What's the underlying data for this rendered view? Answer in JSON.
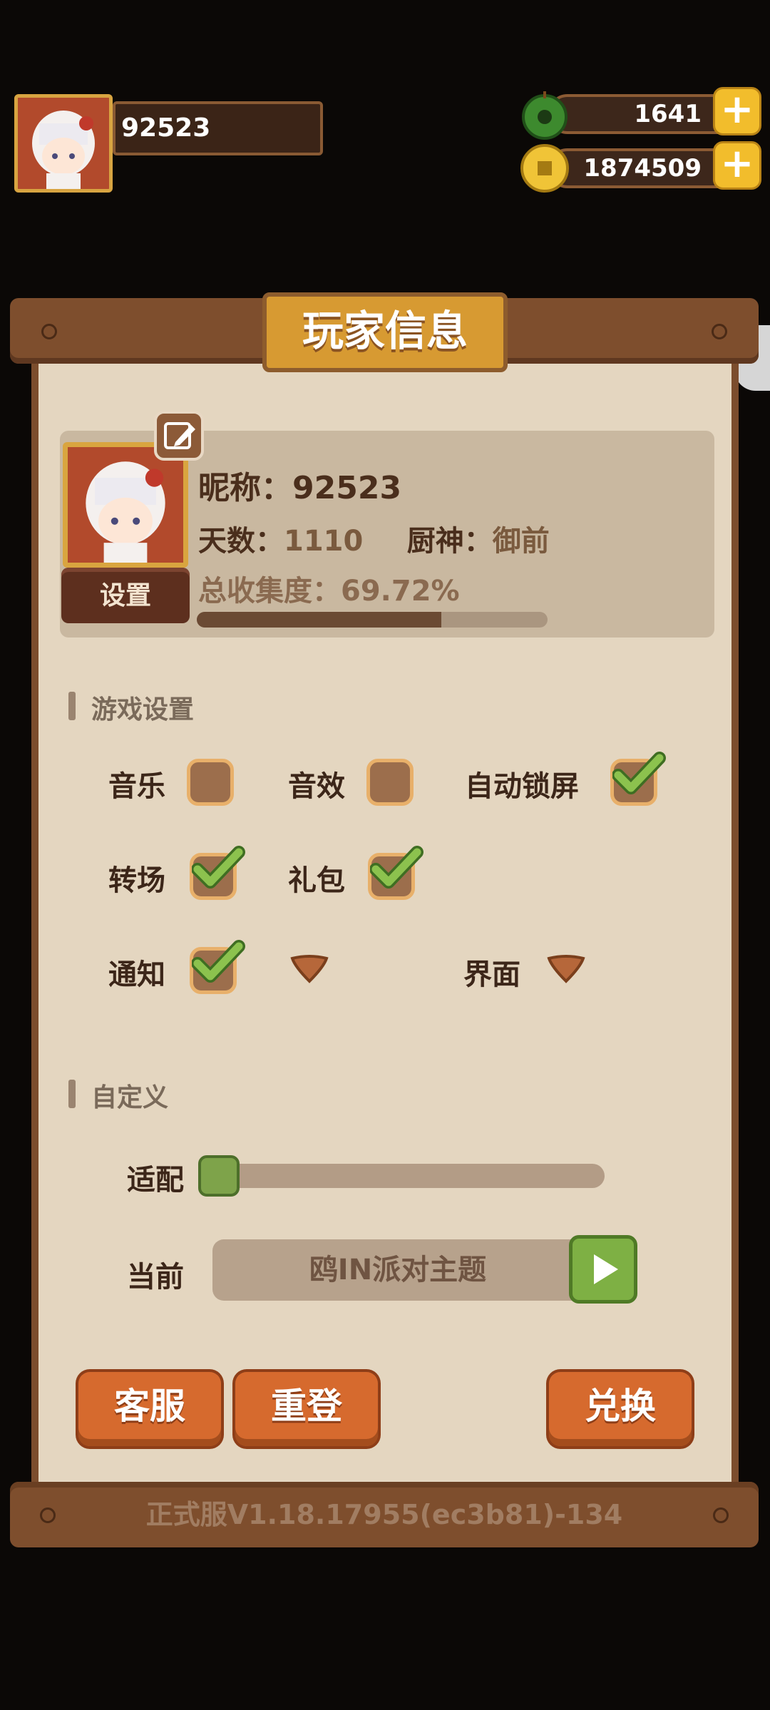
{
  "hud": {
    "player_id": "92523",
    "jade_amount": "1641",
    "coin_amount": "1874509",
    "plus_symbol": "+"
  },
  "panel": {
    "title": "玩家信息",
    "profile": {
      "nickname_label": "昵称：",
      "nickname_value": "92523",
      "days_label": "天数：",
      "days_value": "1110",
      "chef_label": "厨神：",
      "chef_value": "御前",
      "collection_label": "总收集度：",
      "collection_value": "69.72%",
      "collection_fraction": 0.6972,
      "settings_button": "设置"
    },
    "game_settings": {
      "heading": "游戏设置",
      "options": [
        {
          "label": "音乐",
          "checked": false
        },
        {
          "label": "音效",
          "checked": false
        },
        {
          "label": "自动锁屏",
          "checked": true
        },
        {
          "label": "转场",
          "checked": true
        },
        {
          "label": "礼包",
          "checked": true
        },
        {
          "label": "通知",
          "checked": true
        }
      ],
      "dropdown_label": "界面"
    },
    "custom": {
      "heading": "自定义",
      "fit_label": "适配",
      "fit_level": 0,
      "current_label": "当前",
      "current_theme": "鸥IN派对主题"
    },
    "buttons": {
      "service": "客服",
      "relogin": "重登",
      "redeem": "兑换"
    },
    "version": "正式服V1.18.17955(ec3b81)-134"
  },
  "colors": {
    "wood": "#7e4e2d",
    "parchment": "#e4d6c0",
    "gold": "#d79a32",
    "check_green": "#7eb044",
    "orange_button": "#d66a2e"
  }
}
